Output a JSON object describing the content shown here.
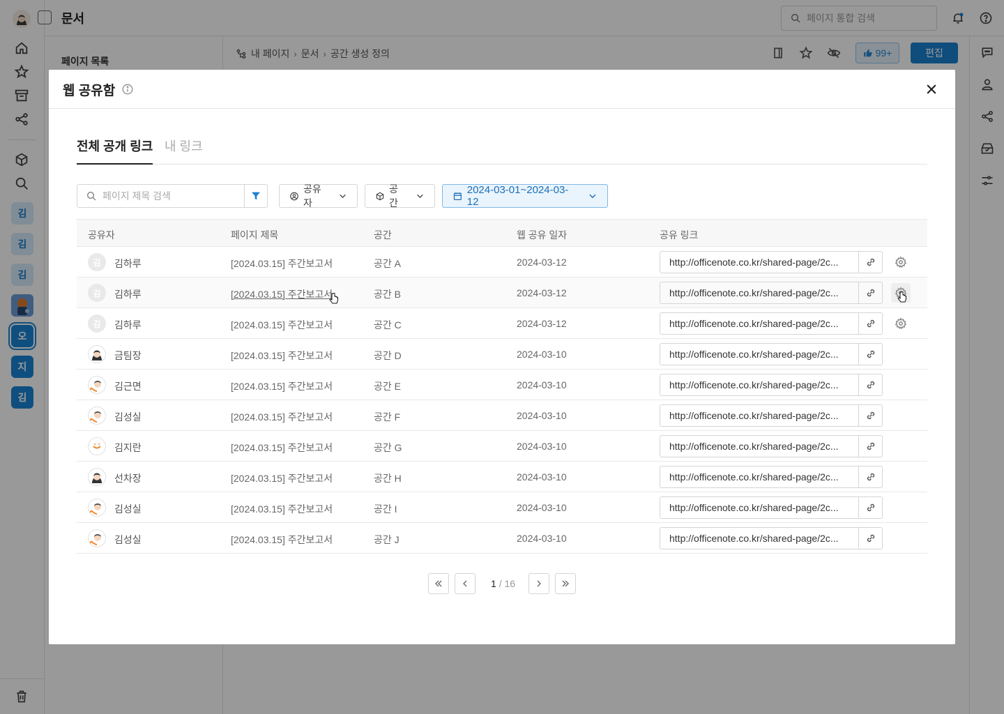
{
  "app": {
    "title": "문서",
    "search_placeholder": "페이지 통합 검색"
  },
  "left_rail": {
    "spaces": [
      "김",
      "김",
      "김",
      "오",
      "지",
      "김"
    ]
  },
  "sidebar": {
    "title": "페이지 목록"
  },
  "breadcrumb": {
    "items": [
      "내 페이지",
      "문서",
      "공간 생성 정의"
    ]
  },
  "toolbar": {
    "likes": "99+",
    "edit_label": "편집"
  },
  "modal": {
    "title": "웹 공유함",
    "tabs": [
      "전체 공개 링크",
      "내 링크"
    ],
    "filters": {
      "search_placeholder": "페이지 제목 검색",
      "sharer_label": "공유자",
      "space_label": "공간",
      "date_range": "2024-03-01~2024-03-12"
    },
    "columns": [
      "공유자",
      "페이지 제목",
      "공간",
      "웹 공유 일자",
      "공유 링크"
    ],
    "rows": [
      {
        "sharer": "김하루",
        "avatar": "김",
        "title": "[2024.03.15] 주간보고서",
        "space": "공간 A",
        "date": "2024-03-12",
        "link": "http://officenote.co.kr/shared-page/2c...",
        "settings": true
      },
      {
        "sharer": "김하루",
        "avatar": "김",
        "title": "[2024.03.15] 주간보고서",
        "space": "공간 B",
        "date": "2024-03-12",
        "link": "http://officenote.co.kr/shared-page/2c...",
        "settings": true
      },
      {
        "sharer": "김하루",
        "avatar": "김",
        "title": "[2024.03.15] 주간보고서",
        "space": "공간 C",
        "date": "2024-03-12",
        "link": "http://officenote.co.kr/shared-page/2c...",
        "settings": true
      },
      {
        "sharer": "금팀장",
        "avatar": "",
        "title": "[2024.03.15] 주간보고서",
        "space": "공간 D",
        "date": "2024-03-10",
        "link": "http://officenote.co.kr/shared-page/2c...",
        "settings": false
      },
      {
        "sharer": "김근면",
        "avatar": "",
        "title": "[2024.03.15] 주간보고서",
        "space": "공간 E",
        "date": "2024-03-10",
        "link": "http://officenote.co.kr/shared-page/2c...",
        "settings": false
      },
      {
        "sharer": "김성실",
        "avatar": "",
        "title": "[2024.03.15] 주간보고서",
        "space": "공간 F",
        "date": "2024-03-10",
        "link": "http://officenote.co.kr/shared-page/2c...",
        "settings": false
      },
      {
        "sharer": "김지란",
        "avatar": "",
        "title": "[2024.03.15] 주간보고서",
        "space": "공간 G",
        "date": "2024-03-10",
        "link": "http://officenote.co.kr/shared-page/2c...",
        "settings": false
      },
      {
        "sharer": "선차장",
        "avatar": "",
        "title": "[2024.03.15] 주간보고서",
        "space": "공간 H",
        "date": "2024-03-10",
        "link": "http://officenote.co.kr/shared-page/2c...",
        "settings": false
      },
      {
        "sharer": "김성실",
        "avatar": "",
        "title": "[2024.03.15] 주간보고서",
        "space": "공간 I",
        "date": "2024-03-10",
        "link": "http://officenote.co.kr/shared-page/2c...",
        "settings": false
      },
      {
        "sharer": "김성실",
        "avatar": "",
        "title": "[2024.03.15] 주간보고서",
        "space": "공간 J",
        "date": "2024-03-10",
        "link": "http://officenote.co.kr/shared-page/2c...",
        "settings": false
      }
    ],
    "pagination": {
      "current": "1",
      "total": "/ 16"
    }
  },
  "colors": {
    "accent": "#1a80d0",
    "overlay": "rgba(0,0,0,0.40)"
  }
}
